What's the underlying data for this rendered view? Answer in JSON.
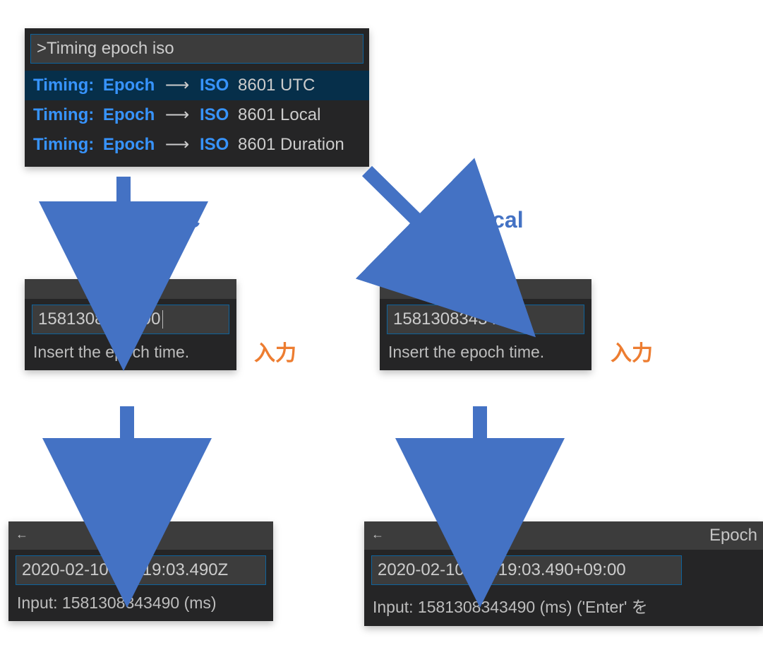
{
  "palette": {
    "input": ">Timing epoch iso",
    "rows": [
      {
        "prefix": "Timing:",
        "mid": "Epoch",
        "arrow": "⟶",
        "iso": "ISO",
        "suffix": "8601 UTC",
        "selected": true
      },
      {
        "prefix": "Timing:",
        "mid": "Epoch",
        "arrow": "⟶",
        "iso": "ISO",
        "suffix": "8601 Local",
        "selected": false
      },
      {
        "prefix": "Timing:",
        "mid": "Epoch",
        "arrow": "⟶",
        "iso": "ISO",
        "suffix": "8601 Duration",
        "selected": false
      }
    ]
  },
  "labels": {
    "utc": "UTC",
    "local": "Local",
    "input_note": "入力"
  },
  "utc": {
    "input_value": "1581308343490",
    "input_help": "Insert the epoch time.",
    "result_value": "2020-02-10T04:19:03.490Z",
    "result_help": "Input: 1581308343490 (ms)"
  },
  "local": {
    "input_value": "1581308343490",
    "input_help": "Insert the epoch time.",
    "result_title": "Epoch",
    "result_value": "2020-02-10T13:19:03.490+09:00",
    "result_help": "Input: 1581308343490 (ms) ('Enter' を"
  },
  "icons": {
    "back": "←"
  }
}
